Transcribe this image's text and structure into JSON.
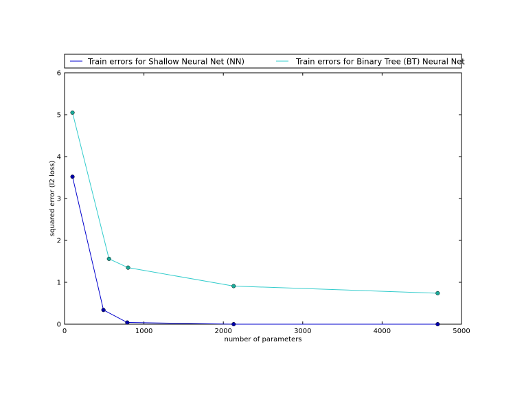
{
  "chart_data": {
    "type": "line",
    "title": "",
    "xlabel": "number of parameters",
    "ylabel": "squared error (l2 loss)",
    "xlim": [
      0,
      5000
    ],
    "ylim": [
      0,
      6
    ],
    "xticks": [
      0,
      1000,
      2000,
      3000,
      4000,
      5000
    ],
    "yticks": [
      0,
      1,
      2,
      3,
      4,
      5,
      6
    ],
    "grid": false,
    "legend_position": "top",
    "series": [
      {
        "name": "Train errors for Shallow Neural Net (NN)",
        "color": "#0000cc",
        "marker_color": "#0000aa",
        "x": [
          100,
          490,
          790,
          2130,
          4700
        ],
        "y": [
          3.52,
          0.34,
          0.04,
          0.0,
          0.0
        ]
      },
      {
        "name": "Train errors for Binary Tree (BT) Neural Net",
        "color": "#33cccc",
        "marker_color": "#1aaa99",
        "x": [
          100,
          560,
          800,
          2130,
          4700
        ],
        "y": [
          5.05,
          1.56,
          1.35,
          0.91,
          0.74
        ]
      }
    ]
  }
}
